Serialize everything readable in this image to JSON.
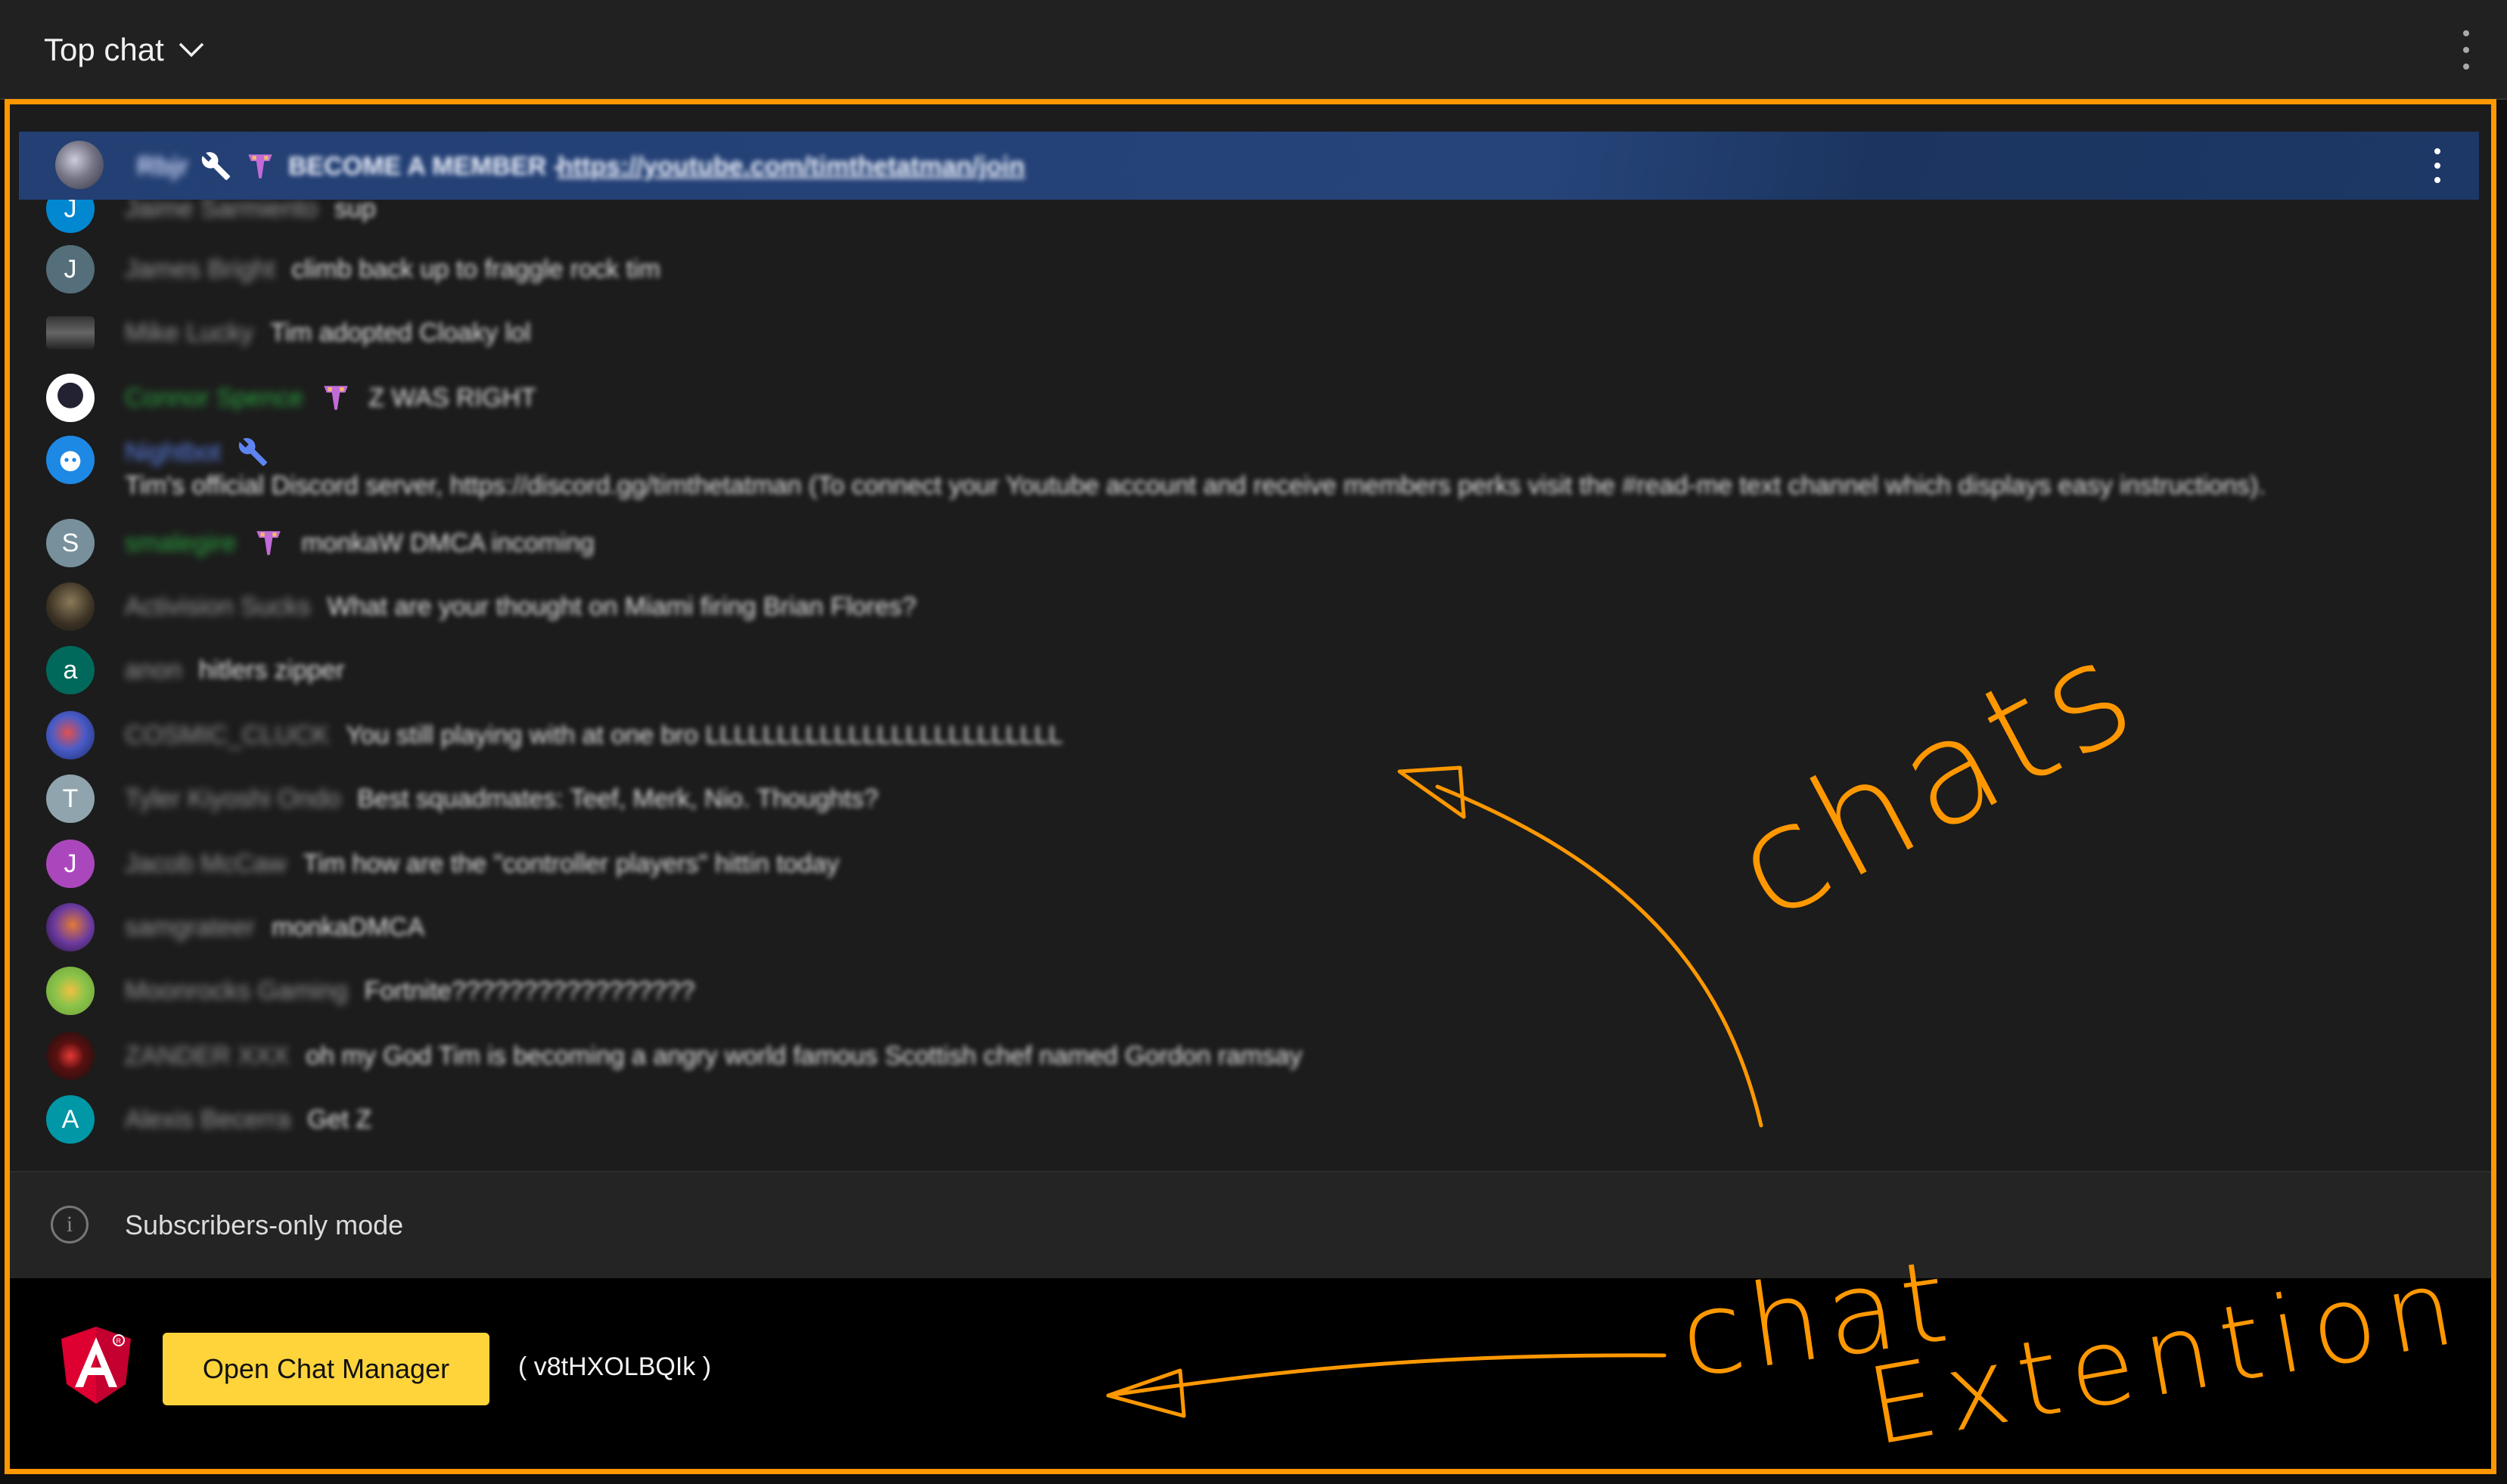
{
  "header": {
    "title": "Top chat"
  },
  "colors": {
    "accent_frame": "#ff9800",
    "pinned_bg": "#26447a",
    "button_bg": "#ffd43b",
    "background": "#1c1c1c"
  },
  "pinned": {
    "author": "Rbjr",
    "message": "BECOME A MEMBER - ",
    "link": "https://youtube.com/timthetatman/join"
  },
  "messages": [
    {
      "author": "Jaime Sarmiento",
      "avatar_letter": "J",
      "text": "sup"
    },
    {
      "author": "James Bright",
      "avatar_letter": "J",
      "text": "climb back up to fraggle rock tim"
    },
    {
      "author": "Mike Lucky",
      "avatar_letter": "",
      "text": "Tim adopted Cloaky lol"
    },
    {
      "author": "Connor Spence",
      "avatar_letter": "",
      "text": "Z WAS RIGHT"
    },
    {
      "author": "Nightbot",
      "avatar_letter": "",
      "text": "Tim's official Discord server, https://discord.gg/timthetatman (To connect your Youtube account and receive members perks visit the #read-me text channel which displays easy instructions)."
    },
    {
      "author": "smalegire",
      "avatar_letter": "S",
      "text": "monkaW DMCA incoming"
    },
    {
      "author": "Activision Sucks",
      "avatar_letter": "",
      "text": "What are your thought on Miami firing Brian Flores?"
    },
    {
      "author": "anon",
      "avatar_letter": "a",
      "text": "hitlers zipper"
    },
    {
      "author": "COSMIC_CLUCK",
      "avatar_letter": "",
      "text": "You still playing with at one bro LLLLLLLLLLLLLLLLLLLLLLLLL"
    },
    {
      "author": "Tyler Kiyoshi Ondo",
      "avatar_letter": "T",
      "text": "Best squadmates: Teef, Merk, Nio. Thoughts?"
    },
    {
      "author": "Jacob McCaw",
      "avatar_letter": "J",
      "text": "Tim how are the \"controller players\" hittin today"
    },
    {
      "author": "samgrateer",
      "avatar_letter": "",
      "text": "monkaDMCA"
    },
    {
      "author": "Moonrocks Gaming",
      "avatar_letter": "",
      "text": "Fortnite?????????????????"
    },
    {
      "author": "ZANDER XXX",
      "avatar_letter": "",
      "text": "oh my God Tim is becoming a angry world famous Scottish chef named Gordon ramsay"
    },
    {
      "author": "Alexis Becerra",
      "avatar_letter": "A",
      "text": "Get Z"
    }
  ],
  "status": {
    "subscribers_only": "Subscribers-only mode"
  },
  "extension": {
    "button_label": "Open Chat Manager",
    "id_text": "( v8tHXOLBQIk )"
  },
  "annotations": {
    "chats": "chats",
    "chat": "chat",
    "extention": "Extention"
  },
  "icons": [
    "chevron-down-icon",
    "more-vert-icon",
    "wrench-icon",
    "member-badge-icon",
    "info-icon",
    "angular-logo-icon"
  ]
}
